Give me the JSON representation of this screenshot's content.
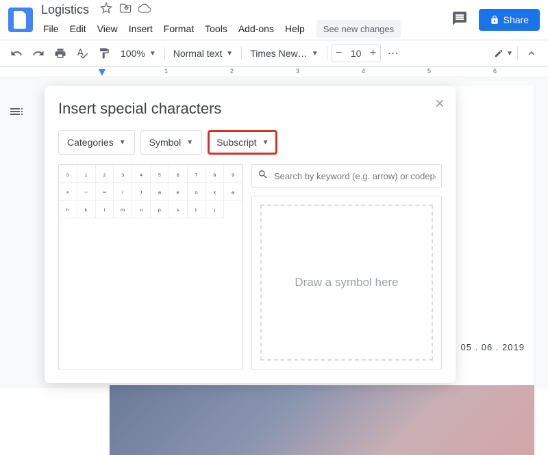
{
  "header": {
    "title": "Logistics",
    "see_changes": "See new changes",
    "share": "Share"
  },
  "menus": [
    "File",
    "Edit",
    "View",
    "Insert",
    "Format",
    "Tools",
    "Add-ons",
    "Help"
  ],
  "toolbar": {
    "zoom": "100%",
    "style": "Normal text",
    "font": "Times New…",
    "font_size": "10"
  },
  "ruler_marks": [
    {
      "pos": 144,
      "label": ""
    },
    {
      "pos": 240,
      "label": "1"
    },
    {
      "pos": 336,
      "label": "2"
    },
    {
      "pos": 432,
      "label": "3"
    },
    {
      "pos": 528,
      "label": "4"
    },
    {
      "pos": 624,
      "label": "5"
    },
    {
      "pos": 720,
      "label": "6"
    }
  ],
  "doc": {
    "date": "05 . 06 . 2019"
  },
  "dialog": {
    "title": "Insert special characters",
    "selects": [
      {
        "label": "Categories",
        "highlighted": false
      },
      {
        "label": "Symbol",
        "highlighted": false
      },
      {
        "label": "Subscript",
        "highlighted": true
      }
    ],
    "characters": [
      "₀",
      "₁",
      "₂",
      "₃",
      "₄",
      "₅",
      "₆",
      "₇",
      "₈",
      "₉",
      "₊",
      "₋",
      "₌",
      "₍",
      "₎",
      "ₐ",
      "ₑ",
      "ₒ",
      "ₓ",
      "ₔ",
      "ₕ",
      "ₖ",
      "ₗ",
      "ₘ",
      "ₙ",
      "ₚ",
      "ₛ",
      "ₜ",
      "ⱼ"
    ],
    "search_placeholder": "Search by keyword (e.g. arrow) or codepoint",
    "draw_hint": "Draw a symbol here"
  }
}
